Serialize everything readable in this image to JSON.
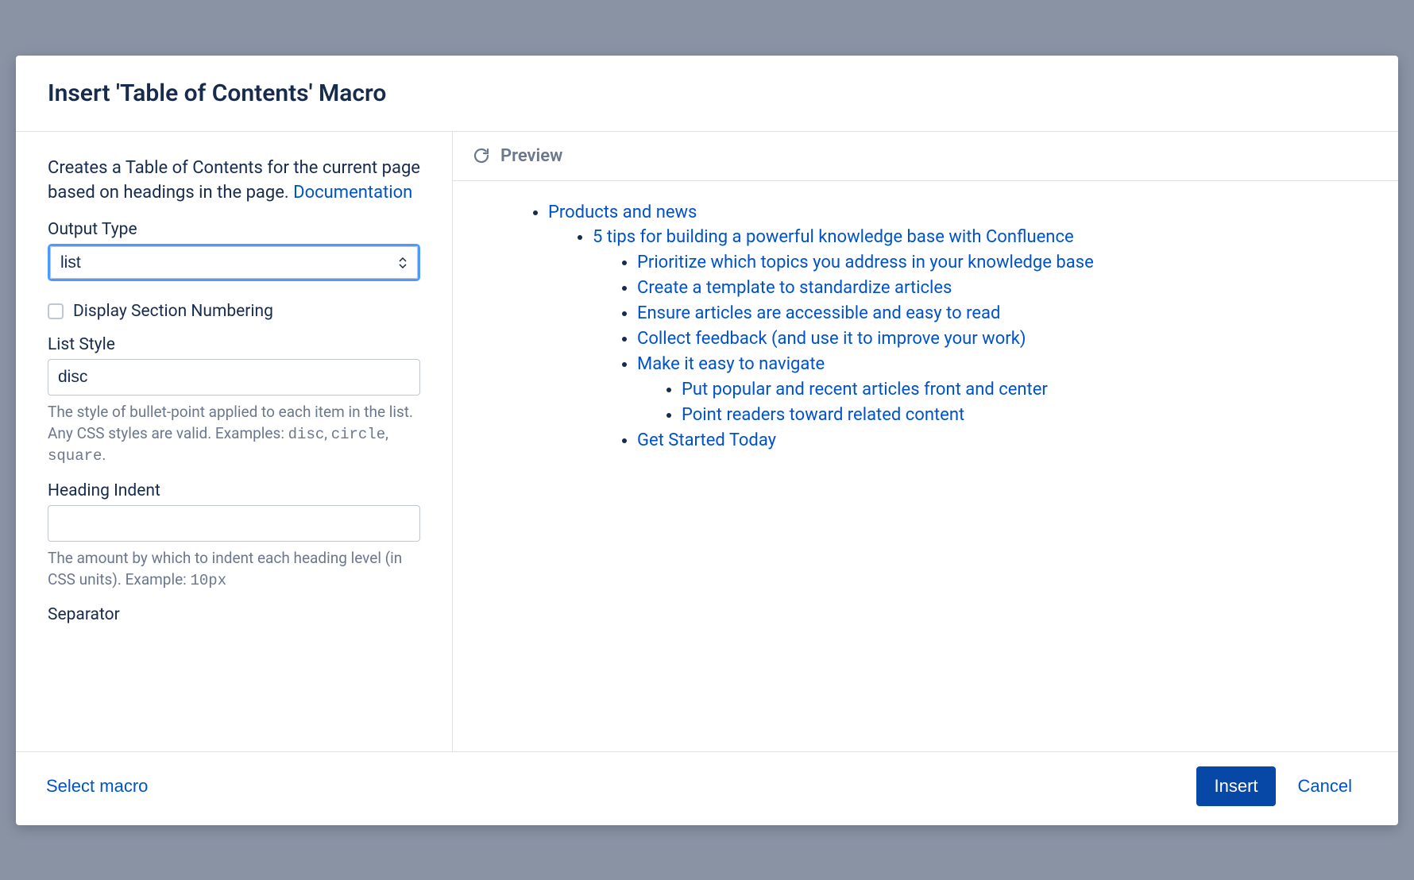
{
  "dialog": {
    "title": "Insert 'Table of Contents' Macro"
  },
  "description": {
    "text_before": "Creates a Table of Contents for the current page based on headings in the page. ",
    "doc_link": "Documentation"
  },
  "fields": {
    "output_type": {
      "label": "Output Type",
      "value": "list"
    },
    "display_section_numbering": {
      "label": "Display Section Numbering",
      "checked": false
    },
    "list_style": {
      "label": "List Style",
      "value": "disc",
      "help_prefix": "The style of bullet-point applied to each item in the list. Any CSS styles are valid. Examples: ",
      "help_code1": "disc",
      "help_sep1": ", ",
      "help_code2": "circle",
      "help_sep2": ", ",
      "help_code3": "square",
      "help_suffix": "."
    },
    "heading_indent": {
      "label": "Heading Indent",
      "value": "",
      "help_prefix": "The amount by which to indent each heading level (in CSS units). Example: ",
      "help_code": "10px"
    },
    "separator": {
      "label": "Separator"
    }
  },
  "preview": {
    "title": "Preview",
    "toc": {
      "l1": "Products and news",
      "l2": "5 tips for building a powerful knowledge base with Confluence",
      "l3a": "Prioritize which topics you address in your knowledge base",
      "l3b": "Create a template to standardize articles",
      "l3c": "Ensure articles are accessible and easy to read",
      "l3d": "Collect feedback (and use it to improve your work)",
      "l3e": "Make it easy to navigate",
      "l4a": "Put popular and recent articles front and center",
      "l4b": "Point readers toward related content",
      "l3f": "Get Started Today"
    }
  },
  "footer": {
    "select_macro": "Select macro",
    "insert": "Insert",
    "cancel": "Cancel"
  }
}
